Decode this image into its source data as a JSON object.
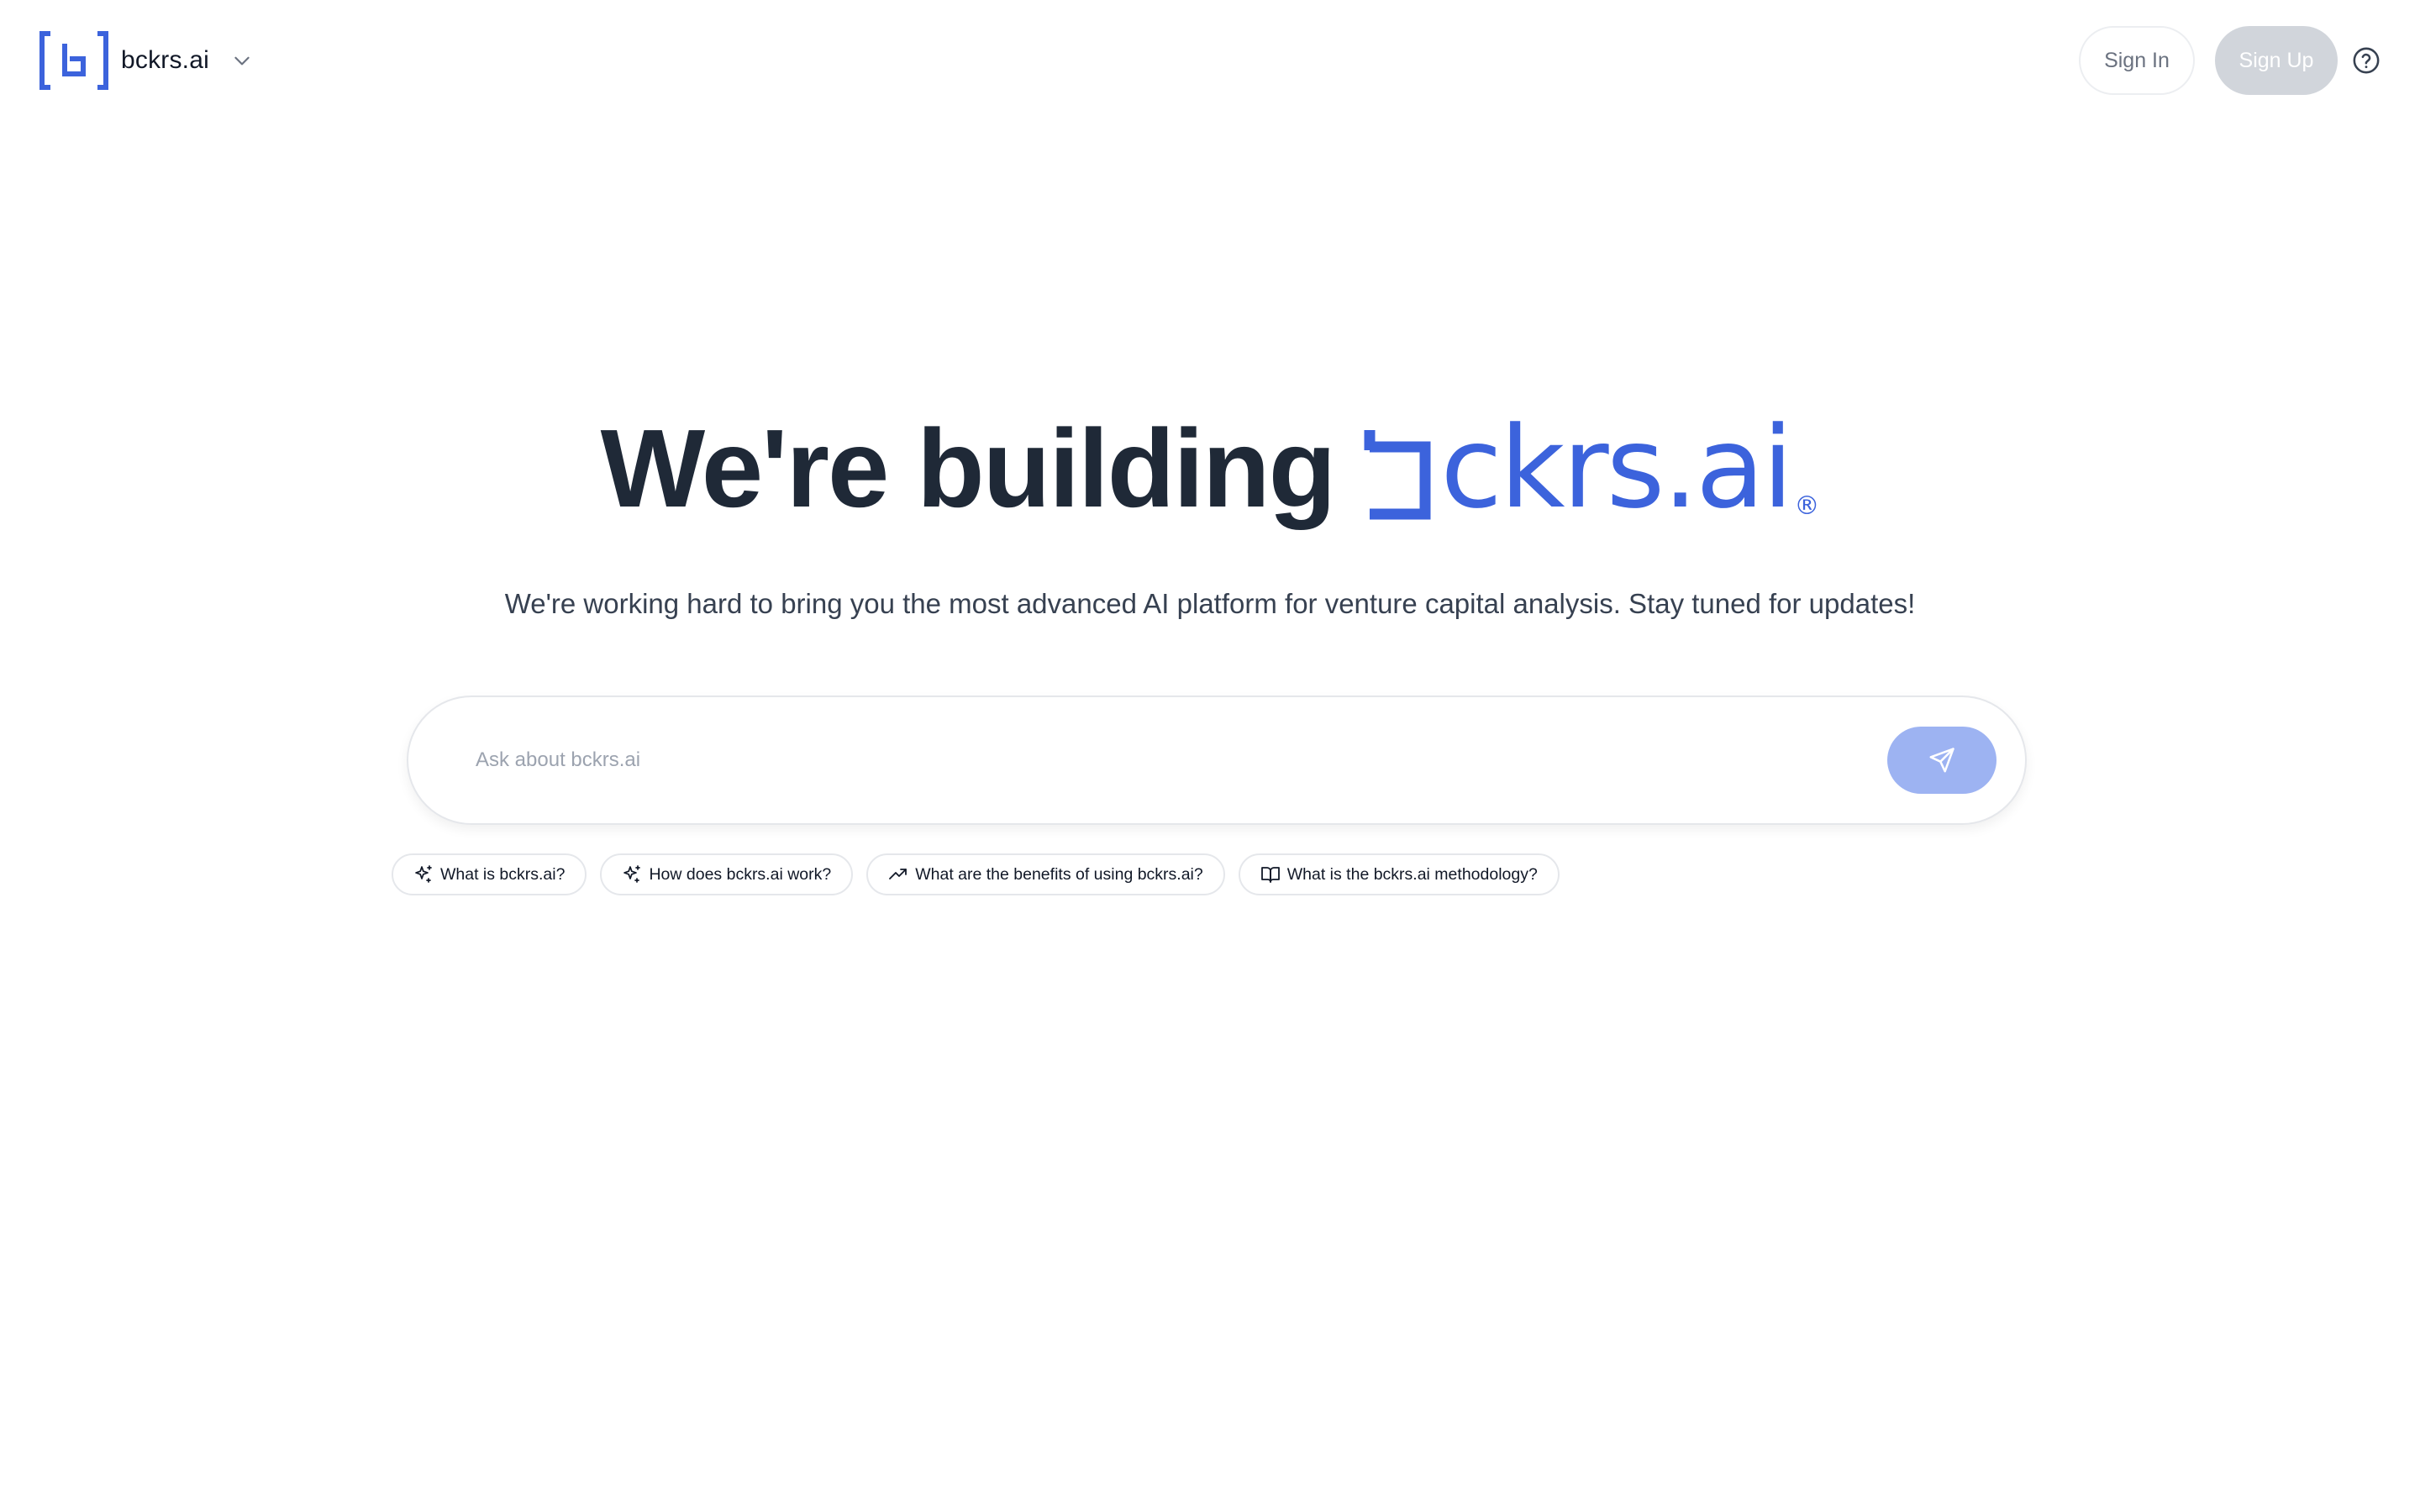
{
  "header": {
    "brand_name": "bckrs.ai",
    "sign_in_label": "Sign In",
    "sign_up_label": "Sign Up"
  },
  "hero": {
    "title_prefix": "We're building",
    "brand_text": "ckrs.ai",
    "registered_mark": "®",
    "subtitle": "We're working hard to bring you the most advanced AI platform for venture capital analysis. Stay tuned for updates!"
  },
  "search": {
    "placeholder": "Ask about bckrs.ai",
    "value": ""
  },
  "suggestions": [
    {
      "label": "What is bckrs.ai?",
      "icon": "sparkles-icon"
    },
    {
      "label": "How does bckrs.ai work?",
      "icon": "sparkles-icon"
    },
    {
      "label": "What are the benefits of using bckrs.ai?",
      "icon": "trending-up-icon"
    },
    {
      "label": "What is the bckrs.ai methodology?",
      "icon": "book-open-icon"
    }
  ],
  "colors": {
    "brand_blue": "#3c63dc",
    "send_button": "#9db3f2",
    "sign_up_button": "#d1d5db",
    "heading": "#1f2937"
  }
}
